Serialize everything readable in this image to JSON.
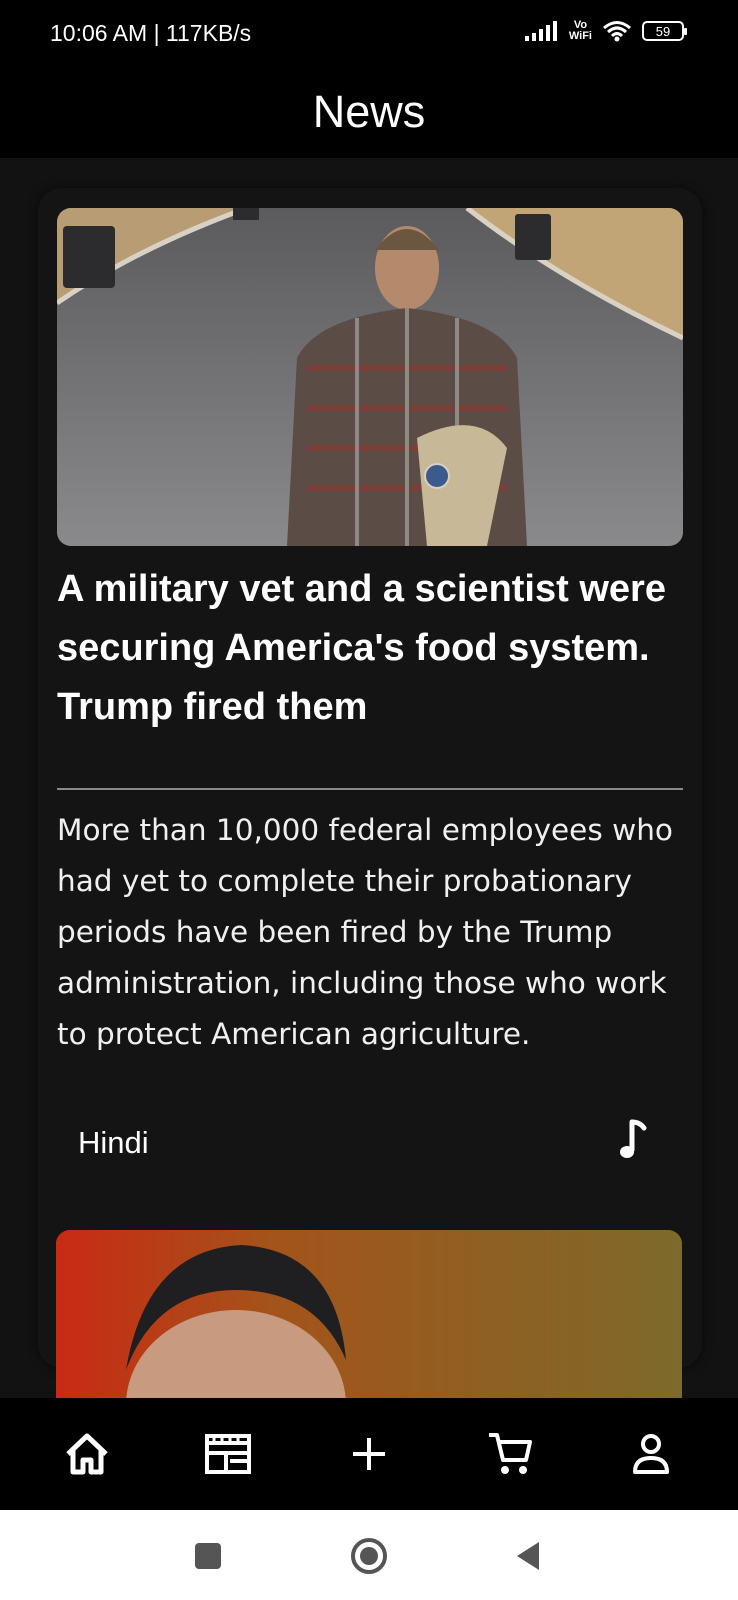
{
  "status_bar": {
    "time": "10:06 AM | 117KB/s",
    "vowifi_top": "Vo",
    "vowifi_bottom": "WiFi",
    "battery": "59"
  },
  "header": {
    "title": "News"
  },
  "articles": [
    {
      "title": "A military vet and a scientist were securing America's food system. Trump fired them",
      "summary": "More than 10,000 federal employees who had yet to complete their probationary periods have been fired by the Trump administration, including those who work to protect American agriculture.",
      "language": "Hindi",
      "audio_icon": "music-note-icon"
    }
  ],
  "bottom_nav": {
    "items": [
      {
        "icon": "home-icon"
      },
      {
        "icon": "newspaper-icon"
      },
      {
        "icon": "plus-icon"
      },
      {
        "icon": "cart-icon"
      },
      {
        "icon": "profile-icon"
      }
    ]
  },
  "system_nav": {
    "items": [
      {
        "icon": "recents-square-icon"
      },
      {
        "icon": "home-circle-icon"
      },
      {
        "icon": "back-triangle-icon"
      }
    ]
  },
  "colors": {
    "background": "#121212",
    "bars": "#000000",
    "text": "#ffffff"
  }
}
